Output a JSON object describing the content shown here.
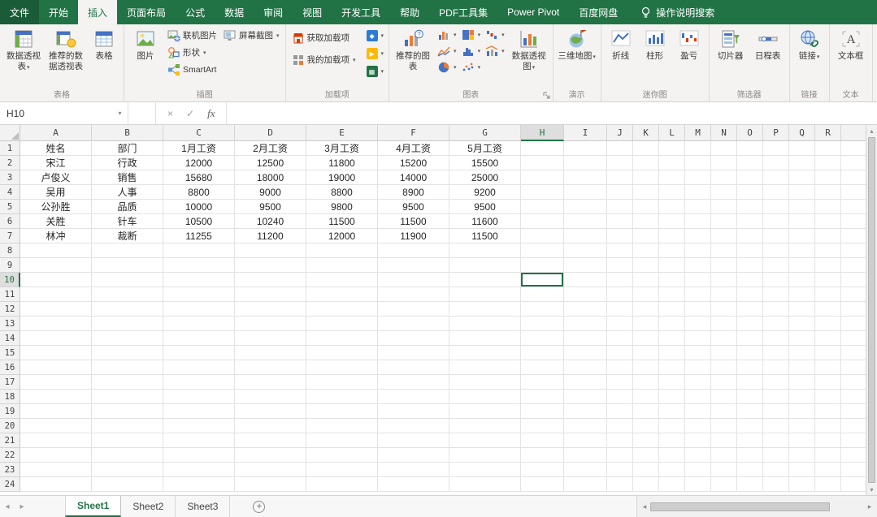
{
  "colors": {
    "accent": "#217346"
  },
  "icons": {
    "chevron_down": "▾",
    "close": "×",
    "check": "✓",
    "fx": "fx",
    "nav_left": "◂",
    "nav_right": "▸",
    "scroll_up": "▴",
    "scroll_down": "▾",
    "plus": "+"
  },
  "menubar": {
    "tabs": [
      "文件",
      "开始",
      "插入",
      "页面布局",
      "公式",
      "数据",
      "审阅",
      "视图",
      "开发工具",
      "帮助",
      "PDF工具集",
      "Power Pivot",
      "百度网盘"
    ],
    "active_tab": "插入",
    "search_label": "操作说明搜索"
  },
  "ribbon": {
    "labels": {
      "pivottable": "数据透视表",
      "recommended_pivottable": "推荐的数据透视表",
      "table": "表格",
      "pictures": "图片",
      "online_pictures": "联机图片",
      "shapes": "形状",
      "smartart": "SmartArt",
      "screenshot": "屏幕截图",
      "get_addins": "获取加载项",
      "my_addins": "我的加载项",
      "recommended_charts": "推荐的图表",
      "pivotchart": "数据透视图",
      "map_3d": "三维地图",
      "spark_line": "折线",
      "spark_column": "柱形",
      "spark_winloss": "盈亏",
      "slicer": "切片器",
      "timeline": "日程表",
      "link": "链接",
      "textbox": "文本框"
    },
    "groups": {
      "tables": "表格",
      "illustrations": "插图",
      "addins": "加载项",
      "charts": "图表",
      "tours": "演示",
      "sparklines": "迷你图",
      "filters": "筛选器",
      "links": "链接",
      "text": "文本"
    }
  },
  "formula_bar": {
    "name_box": "H10",
    "formula": ""
  },
  "grid": {
    "columns": [
      "A",
      "B",
      "C",
      "D",
      "E",
      "F",
      "G",
      "H",
      "I",
      "J",
      "K",
      "L",
      "M",
      "N",
      "O",
      "P",
      "Q",
      "R"
    ],
    "row_count": 24,
    "selected": {
      "col": "H",
      "row": 10
    }
  },
  "sheet": {
    "cells": [
      [
        "姓名",
        "部门",
        "1月工资",
        "2月工资",
        "3月工资",
        "4月工资",
        "5月工资"
      ],
      [
        "宋江",
        "行政",
        "12000",
        "12500",
        "11800",
        "15200",
        "15500"
      ],
      [
        "卢俊义",
        "销售",
        "15680",
        "18000",
        "19000",
        "14000",
        "25000"
      ],
      [
        "吴用",
        "人事",
        "8800",
        "9000",
        "8800",
        "8900",
        "9200"
      ],
      [
        "公孙胜",
        "品质",
        "10000",
        "9500",
        "9800",
        "9500",
        "9500"
      ],
      [
        "关胜",
        "针车",
        "10500",
        "10240",
        "11500",
        "11500",
        "11600"
      ],
      [
        "林冲",
        "裁断",
        "11255",
        "11200",
        "12000",
        "11900",
        "11500"
      ]
    ]
  },
  "sheet_tabs": {
    "tabs": [
      "Sheet1",
      "Sheet2",
      "Sheet3"
    ],
    "active": "Sheet1"
  }
}
